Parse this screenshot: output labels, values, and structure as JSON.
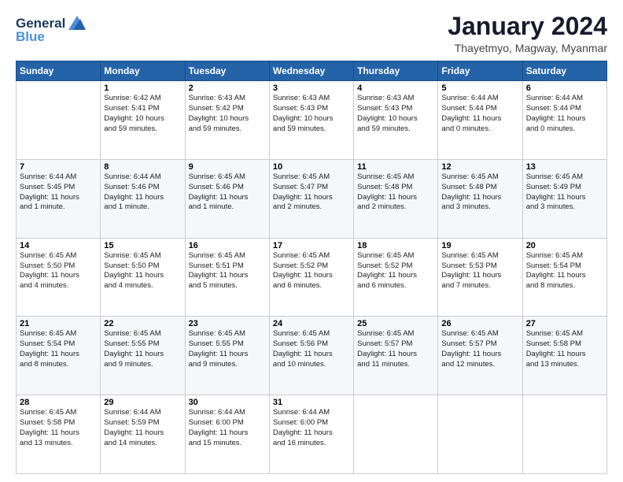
{
  "logo": {
    "line1": "General",
    "line2": "Blue"
  },
  "header": {
    "month": "January 2024",
    "location": "Thayetmyo, Magway, Myanmar"
  },
  "weekdays": [
    "Sunday",
    "Monday",
    "Tuesday",
    "Wednesday",
    "Thursday",
    "Friday",
    "Saturday"
  ],
  "weeks": [
    [
      {
        "day": "",
        "info": ""
      },
      {
        "day": "1",
        "info": "Sunrise: 6:42 AM\nSunset: 5:41 PM\nDaylight: 10 hours\nand 59 minutes."
      },
      {
        "day": "2",
        "info": "Sunrise: 6:43 AM\nSunset: 5:42 PM\nDaylight: 10 hours\nand 59 minutes."
      },
      {
        "day": "3",
        "info": "Sunrise: 6:43 AM\nSunset: 5:43 PM\nDaylight: 10 hours\nand 59 minutes."
      },
      {
        "day": "4",
        "info": "Sunrise: 6:43 AM\nSunset: 5:43 PM\nDaylight: 10 hours\nand 59 minutes."
      },
      {
        "day": "5",
        "info": "Sunrise: 6:44 AM\nSunset: 5:44 PM\nDaylight: 11 hours\nand 0 minutes."
      },
      {
        "day": "6",
        "info": "Sunrise: 6:44 AM\nSunset: 5:44 PM\nDaylight: 11 hours\nand 0 minutes."
      }
    ],
    [
      {
        "day": "7",
        "info": "Sunrise: 6:44 AM\nSunset: 5:45 PM\nDaylight: 11 hours\nand 1 minute."
      },
      {
        "day": "8",
        "info": "Sunrise: 6:44 AM\nSunset: 5:46 PM\nDaylight: 11 hours\nand 1 minute."
      },
      {
        "day": "9",
        "info": "Sunrise: 6:45 AM\nSunset: 5:46 PM\nDaylight: 11 hours\nand 1 minute."
      },
      {
        "day": "10",
        "info": "Sunrise: 6:45 AM\nSunset: 5:47 PM\nDaylight: 11 hours\nand 2 minutes."
      },
      {
        "day": "11",
        "info": "Sunrise: 6:45 AM\nSunset: 5:48 PM\nDaylight: 11 hours\nand 2 minutes."
      },
      {
        "day": "12",
        "info": "Sunrise: 6:45 AM\nSunset: 5:48 PM\nDaylight: 11 hours\nand 3 minutes."
      },
      {
        "day": "13",
        "info": "Sunrise: 6:45 AM\nSunset: 5:49 PM\nDaylight: 11 hours\nand 3 minutes."
      }
    ],
    [
      {
        "day": "14",
        "info": "Sunrise: 6:45 AM\nSunset: 5:50 PM\nDaylight: 11 hours\nand 4 minutes."
      },
      {
        "day": "15",
        "info": "Sunrise: 6:45 AM\nSunset: 5:50 PM\nDaylight: 11 hours\nand 4 minutes."
      },
      {
        "day": "16",
        "info": "Sunrise: 6:45 AM\nSunset: 5:51 PM\nDaylight: 11 hours\nand 5 minutes."
      },
      {
        "day": "17",
        "info": "Sunrise: 6:45 AM\nSunset: 5:52 PM\nDaylight: 11 hours\nand 6 minutes."
      },
      {
        "day": "18",
        "info": "Sunrise: 6:45 AM\nSunset: 5:52 PM\nDaylight: 11 hours\nand 6 minutes."
      },
      {
        "day": "19",
        "info": "Sunrise: 6:45 AM\nSunset: 5:53 PM\nDaylight: 11 hours\nand 7 minutes."
      },
      {
        "day": "20",
        "info": "Sunrise: 6:45 AM\nSunset: 5:54 PM\nDaylight: 11 hours\nand 8 minutes."
      }
    ],
    [
      {
        "day": "21",
        "info": "Sunrise: 6:45 AM\nSunset: 5:54 PM\nDaylight: 11 hours\nand 8 minutes."
      },
      {
        "day": "22",
        "info": "Sunrise: 6:45 AM\nSunset: 5:55 PM\nDaylight: 11 hours\nand 9 minutes."
      },
      {
        "day": "23",
        "info": "Sunrise: 6:45 AM\nSunset: 5:55 PM\nDaylight: 11 hours\nand 9 minutes."
      },
      {
        "day": "24",
        "info": "Sunrise: 6:45 AM\nSunset: 5:56 PM\nDaylight: 11 hours\nand 10 minutes."
      },
      {
        "day": "25",
        "info": "Sunrise: 6:45 AM\nSunset: 5:57 PM\nDaylight: 11 hours\nand 11 minutes."
      },
      {
        "day": "26",
        "info": "Sunrise: 6:45 AM\nSunset: 5:57 PM\nDaylight: 11 hours\nand 12 minutes."
      },
      {
        "day": "27",
        "info": "Sunrise: 6:45 AM\nSunset: 5:58 PM\nDaylight: 11 hours\nand 13 minutes."
      }
    ],
    [
      {
        "day": "28",
        "info": "Sunrise: 6:45 AM\nSunset: 5:58 PM\nDaylight: 11 hours\nand 13 minutes."
      },
      {
        "day": "29",
        "info": "Sunrise: 6:44 AM\nSunset: 5:59 PM\nDaylight: 11 hours\nand 14 minutes."
      },
      {
        "day": "30",
        "info": "Sunrise: 6:44 AM\nSunset: 6:00 PM\nDaylight: 11 hours\nand 15 minutes."
      },
      {
        "day": "31",
        "info": "Sunrise: 6:44 AM\nSunset: 6:00 PM\nDaylight: 11 hours\nand 16 minutes."
      },
      {
        "day": "",
        "info": ""
      },
      {
        "day": "",
        "info": ""
      },
      {
        "day": "",
        "info": ""
      }
    ]
  ]
}
